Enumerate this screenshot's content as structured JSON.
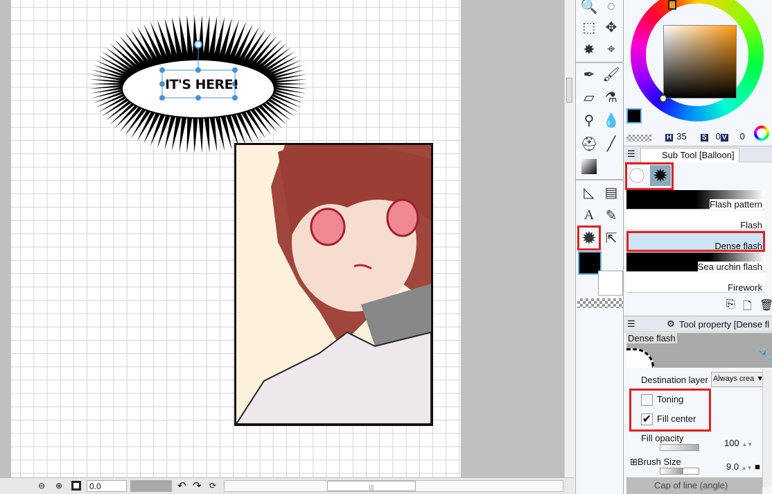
{
  "canvas": {
    "balloon_text": "IT'S HERE!"
  },
  "bottombar": {
    "rotation_value": "0.0",
    "icons": [
      "zoom-out-icon",
      "zoom-in-icon",
      "fit-icon",
      "rotate-left-icon",
      "rotate-right-icon",
      "reset-rotation-icon"
    ]
  },
  "color": {
    "h_label": "H",
    "h": "35",
    "s_label": "S",
    "s": "0",
    "v_label": "V",
    "v": "0",
    "main_color": "#000000",
    "sub_color": "#ffffff"
  },
  "subtool": {
    "title": "Sub Tool [Balloon]",
    "items": [
      {
        "label": "Flash pattern"
      },
      {
        "label": "Flash"
      },
      {
        "label": "Dense flash",
        "selected": true
      },
      {
        "label": "Sea urchin flash"
      },
      {
        "label": "Firework"
      }
    ]
  },
  "toolprop": {
    "title": "Tool property [Dense fl",
    "preview_label": "Dense flash",
    "destination_layer_label": "Destination layer",
    "destination_layer_value": "Always crea",
    "toning_label": "Toning",
    "toning_checked": false,
    "fill_center_label": "Fill center",
    "fill_center_checked": true,
    "fill_opacity_label": "Fill opacity",
    "fill_opacity": "100",
    "brush_size_label": "Brush Size",
    "brush_size": "9.0",
    "cap_label": "Cap of line (angle)"
  },
  "accent": "#e02020"
}
